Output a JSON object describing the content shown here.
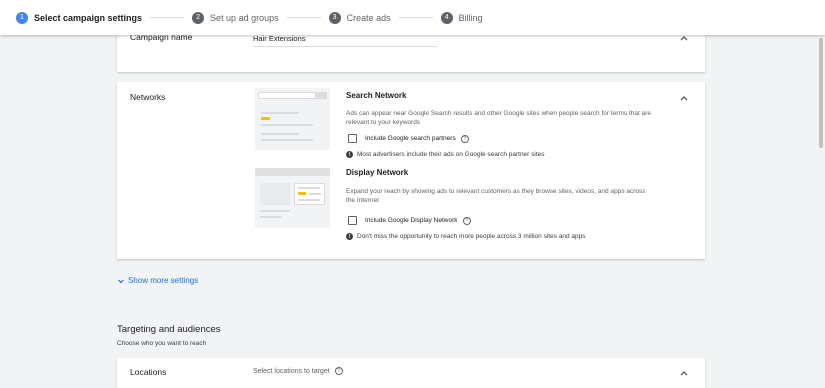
{
  "stepper": {
    "steps": [
      {
        "num": "1",
        "label": "Select campaign settings"
      },
      {
        "num": "2",
        "label": "Set up ad groups"
      },
      {
        "num": "3",
        "label": "Create ads"
      },
      {
        "num": "4",
        "label": "Billing"
      }
    ]
  },
  "campaign_name_card": {
    "label": "Campaign name",
    "value": "Hair Extensions"
  },
  "networks_card": {
    "label": "Networks",
    "search": {
      "title": "Search Network",
      "description": "Ads can appear near Google Search results and other Google sites when people search for terms that are relevant to your keywords",
      "checkbox_label": "Include Google search partners",
      "note": "Most advertisers include their ads on Google search partner sites"
    },
    "display": {
      "title": "Display Network",
      "description": "Expand your reach by showing ads to relevant customers as they browse sites, videos, and apps across the Internet",
      "checkbox_label": "Include Google Display Network",
      "note": "Don't miss the opportunity to reach more people across 3 million sites and apps"
    }
  },
  "show_more": "Show more settings",
  "targeting": {
    "title": "Targeting and audiences",
    "subtitle": "Choose who you want to reach"
  },
  "locations_card": {
    "label": "Locations",
    "placeholder": "Select locations to target"
  },
  "colors": {
    "accent": "#4285f4",
    "link": "#1a73e8",
    "highlight": "#fbbc04"
  }
}
